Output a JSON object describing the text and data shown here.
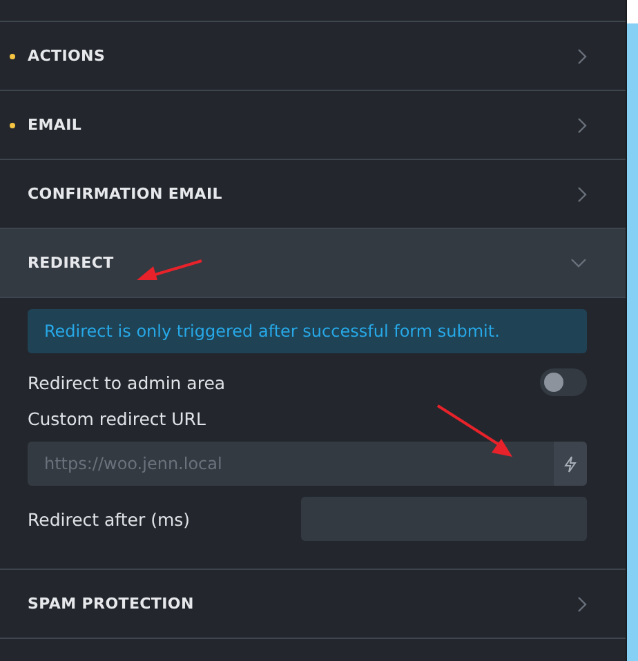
{
  "sections": [
    {
      "label": "ACTIONS",
      "modified": true,
      "expanded": false
    },
    {
      "label": "EMAIL",
      "modified": true,
      "expanded": false
    },
    {
      "label": "CONFIRMATION EMAIL",
      "modified": false,
      "expanded": false
    },
    {
      "label": "REDIRECT",
      "modified": false,
      "expanded": true,
      "content": {
        "notice": "Redirect is only triggered after successful form submit.",
        "admin_toggle": {
          "label": "Redirect to admin area",
          "on": false
        },
        "url_field": {
          "label": "Custom redirect URL",
          "placeholder": "https://woo.jenn.local"
        },
        "delay_field": {
          "label": "Redirect after (ms)"
        }
      }
    },
    {
      "label": "SPAM PROTECTION",
      "modified": false,
      "expanded": false
    }
  ]
}
